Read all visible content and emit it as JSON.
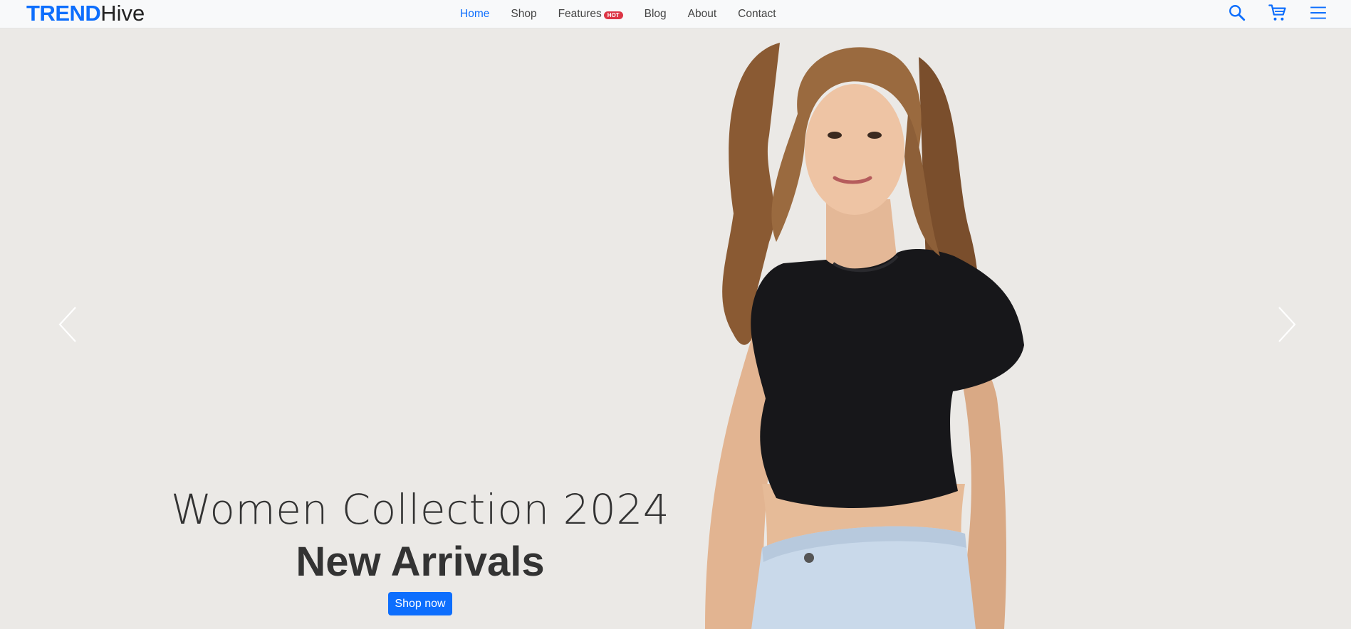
{
  "brand": {
    "part1": "TREND",
    "part2": "Hive"
  },
  "nav": {
    "items": [
      {
        "label": "Home"
      },
      {
        "label": "Shop"
      },
      {
        "label": "Features",
        "badge": "HOT"
      },
      {
        "label": "Blog"
      },
      {
        "label": "About"
      },
      {
        "label": "Contact"
      }
    ]
  },
  "icons": {
    "search": "search-icon",
    "cart": "cart-icon",
    "menu": "hamburger-menu-icon"
  },
  "hero": {
    "subtitle": "Women Collection 2024",
    "title": "New Arrivals",
    "cta_label": "Shop now"
  },
  "colors": {
    "accent": "#0d6efd",
    "badge": "#dc3545",
    "hero_bg": "#ebe9e6",
    "navbar_bg": "#f8f9fa"
  }
}
